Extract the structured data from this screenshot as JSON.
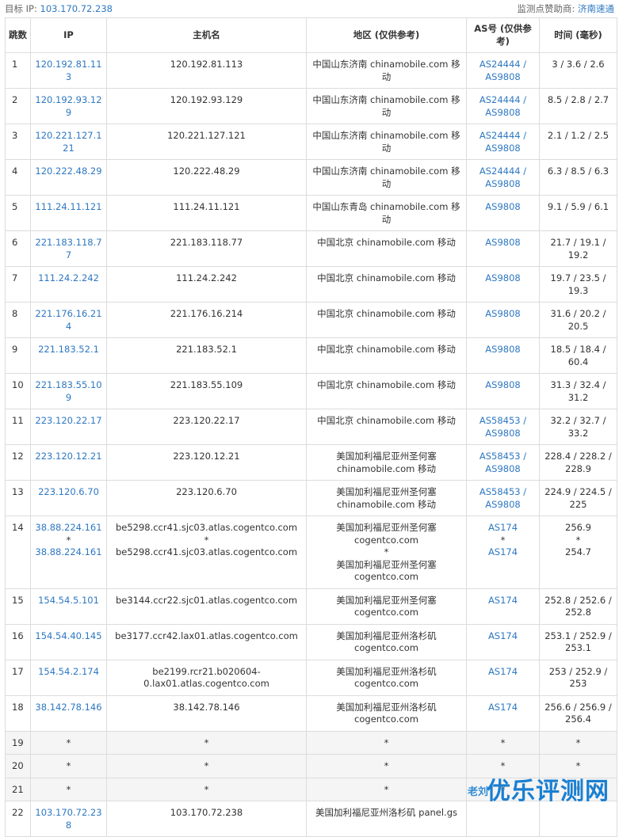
{
  "topbar": {
    "target_label": "目标 IP:",
    "target_ip": "103.170.72.238",
    "sponsor_label": "监测点赞助商:",
    "sponsor_name": "济南速通"
  },
  "columns": [
    "跳数",
    "IP",
    "主机名",
    "地区 (仅供参考)",
    "AS号 (仅供参考)",
    "时间 (毫秒)"
  ],
  "rows": [
    {
      "hop": "1",
      "ip": [
        "120.192.81.113"
      ],
      "host": [
        "120.192.81.113"
      ],
      "region": [
        "中国山东济南 chinamobile.com 移动"
      ],
      "as": [
        "AS24444 /",
        "AS9808"
      ],
      "time": [
        "3 / 3.6 / 2.6"
      ]
    },
    {
      "hop": "2",
      "ip": [
        "120.192.93.129"
      ],
      "host": [
        "120.192.93.129"
      ],
      "region": [
        "中国山东济南 chinamobile.com 移动"
      ],
      "as": [
        "AS24444 /",
        "AS9808"
      ],
      "time": [
        "8.5 / 2.8 / 2.7"
      ]
    },
    {
      "hop": "3",
      "ip": [
        "120.221.127.121"
      ],
      "host": [
        "120.221.127.121"
      ],
      "region": [
        "中国山东济南 chinamobile.com 移动"
      ],
      "as": [
        "AS24444 /",
        "AS9808"
      ],
      "time": [
        "2.1 / 1.2 / 2.5"
      ]
    },
    {
      "hop": "4",
      "ip": [
        "120.222.48.29"
      ],
      "host": [
        "120.222.48.29"
      ],
      "region": [
        "中国山东济南 chinamobile.com 移动"
      ],
      "as": [
        "AS24444 /",
        "AS9808"
      ],
      "time": [
        "6.3 / 8.5 / 6.3"
      ]
    },
    {
      "hop": "5",
      "ip": [
        "111.24.11.121"
      ],
      "host": [
        "111.24.11.121"
      ],
      "region": [
        "中国山东青岛 chinamobile.com 移动"
      ],
      "as": [
        "AS9808"
      ],
      "time": [
        "9.1 / 5.9 / 6.1"
      ]
    },
    {
      "hop": "6",
      "ip": [
        "221.183.118.77"
      ],
      "host": [
        "221.183.118.77"
      ],
      "region": [
        "中国北京 chinamobile.com 移动"
      ],
      "as": [
        "AS9808"
      ],
      "time": [
        "21.7 / 19.1 /",
        "19.2"
      ]
    },
    {
      "hop": "7",
      "ip": [
        "111.24.2.242"
      ],
      "host": [
        "111.24.2.242"
      ],
      "region": [
        "中国北京 chinamobile.com 移动"
      ],
      "as": [
        "AS9808"
      ],
      "time": [
        "19.7 / 23.5 /",
        "19.3"
      ]
    },
    {
      "hop": "8",
      "ip": [
        "221.176.16.214"
      ],
      "host": [
        "221.176.16.214"
      ],
      "region": [
        "中国北京 chinamobile.com 移动"
      ],
      "as": [
        "AS9808"
      ],
      "time": [
        "31.6 / 20.2 /",
        "20.5"
      ]
    },
    {
      "hop": "9",
      "ip": [
        "221.183.52.1"
      ],
      "host": [
        "221.183.52.1"
      ],
      "region": [
        "中国北京 chinamobile.com 移动"
      ],
      "as": [
        "AS9808"
      ],
      "time": [
        "18.5 / 18.4 /",
        "60.4"
      ]
    },
    {
      "hop": "10",
      "ip": [
        "221.183.55.109"
      ],
      "host": [
        "221.183.55.109"
      ],
      "region": [
        "中国北京 chinamobile.com 移动"
      ],
      "as": [
        "AS9808"
      ],
      "time": [
        "31.3 / 32.4 /",
        "31.2"
      ]
    },
    {
      "hop": "11",
      "ip": [
        "223.120.22.17"
      ],
      "host": [
        "223.120.22.17"
      ],
      "region": [
        "中国北京 chinamobile.com 移动"
      ],
      "as": [
        "AS58453 /",
        "AS9808"
      ],
      "time": [
        "32.2 / 32.7 /",
        "33.2"
      ]
    },
    {
      "hop": "12",
      "ip": [
        "223.120.12.21"
      ],
      "host": [
        "223.120.12.21"
      ],
      "region": [
        "美国加利福尼亚州圣何塞",
        "chinamobile.com 移动"
      ],
      "as": [
        "AS58453 /",
        "AS9808"
      ],
      "time": [
        "228.4 / 228.2 /",
        "228.9"
      ]
    },
    {
      "hop": "13",
      "ip": [
        "223.120.6.70"
      ],
      "host": [
        "223.120.6.70"
      ],
      "region": [
        "美国加利福尼亚州圣何塞",
        "chinamobile.com 移动"
      ],
      "as": [
        "AS58453 /",
        "AS9808"
      ],
      "time": [
        "224.9 / 224.5 /",
        "225"
      ]
    },
    {
      "hop": "14",
      "ip": [
        "38.88.224.161",
        "*",
        "38.88.224.161"
      ],
      "host": [
        "be5298.ccr41.sjc03.atlas.cogentco.com",
        "*",
        "be5298.ccr41.sjc03.atlas.cogentco.com"
      ],
      "region": [
        "美国加利福尼亚州圣何塞",
        "cogentco.com",
        "*",
        "美国加利福尼亚州圣何塞",
        "cogentco.com"
      ],
      "as": [
        "AS174",
        "*",
        "AS174"
      ],
      "time": [
        "256.9",
        "*",
        "254.7"
      ]
    },
    {
      "hop": "15",
      "ip": [
        "154.54.5.101"
      ],
      "host": [
        "be3144.ccr22.sjc01.atlas.cogentco.com"
      ],
      "region": [
        "美国加利福尼亚州圣何塞",
        "cogentco.com"
      ],
      "as": [
        "AS174"
      ],
      "time": [
        "252.8 / 252.6 /",
        "252.8"
      ]
    },
    {
      "hop": "16",
      "ip": [
        "154.54.40.145"
      ],
      "host": [
        "be3177.ccr42.lax01.atlas.cogentco.com"
      ],
      "region": [
        "美国加利福尼亚州洛杉矶",
        "cogentco.com"
      ],
      "as": [
        "AS174"
      ],
      "time": [
        "253.1 / 252.9 /",
        "253.1"
      ]
    },
    {
      "hop": "17",
      "ip": [
        "154.54.2.174"
      ],
      "host": [
        "be2199.rcr21.b020604-",
        "0.lax01.atlas.cogentco.com"
      ],
      "region": [
        "美国加利福尼亚州洛杉矶",
        "cogentco.com"
      ],
      "as": [
        "AS174"
      ],
      "time": [
        "253 / 252.9 /",
        "253"
      ]
    },
    {
      "hop": "18",
      "ip": [
        "38.142.78.146"
      ],
      "host": [
        "38.142.78.146"
      ],
      "region": [
        "美国加利福尼亚州洛杉矶",
        "cogentco.com"
      ],
      "as": [
        "AS174"
      ],
      "time": [
        "256.6 / 256.9 /",
        "256.4"
      ]
    },
    {
      "hop": "19",
      "ip": [
        "*"
      ],
      "host": [
        "*"
      ],
      "region": [
        "*"
      ],
      "as": [
        "*"
      ],
      "time": [
        "*"
      ]
    },
    {
      "hop": "20",
      "ip": [
        "*"
      ],
      "host": [
        "*"
      ],
      "region": [
        "*"
      ],
      "as": [
        "*"
      ],
      "time": [
        "*"
      ]
    },
    {
      "hop": "21",
      "ip": [
        "*"
      ],
      "host": [
        "*"
      ],
      "region": [
        "*"
      ],
      "as": [
        "*"
      ],
      "time": [
        "*"
      ]
    },
    {
      "hop": "22",
      "ip": [
        "103.170.72.238"
      ],
      "host": [
        "103.170.72.238"
      ],
      "region": [
        "美国加利福尼亚州洛杉矶 panel.gs"
      ],
      "as": [
        ""
      ],
      "time": [
        ""
      ]
    }
  ],
  "watermark": {
    "small": "老刘",
    "big": "优乐评测网"
  }
}
